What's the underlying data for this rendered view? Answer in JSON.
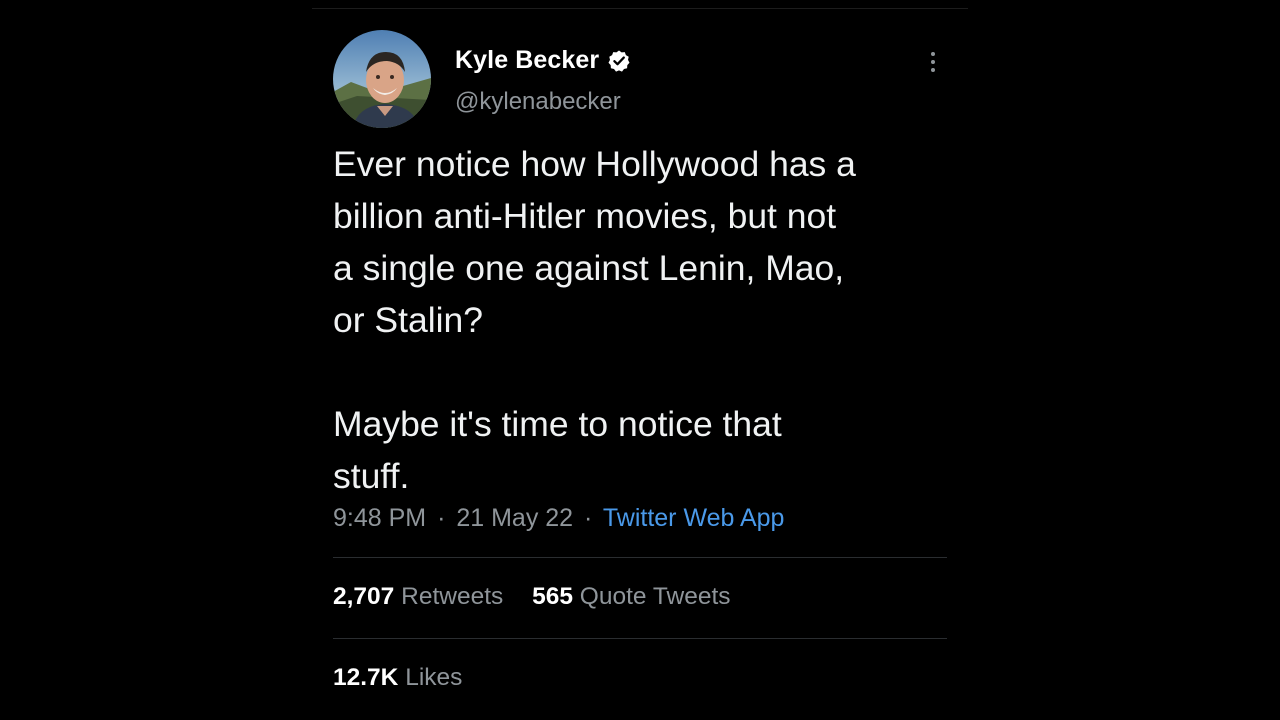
{
  "tweet": {
    "author": {
      "display_name": "Kyle Becker",
      "handle": "@kylenabecker",
      "verified": true
    },
    "body": "Ever notice how Hollywood has a\nbillion anti-Hitler movies, but not\na single one against Lenin, Mao,\nor Stalin?\n\nMaybe it's time to notice that\nstuff.",
    "meta": {
      "time": "9:48 PM",
      "separator": "·",
      "date": "21 May 22",
      "source": "Twitter Web App"
    },
    "stats": {
      "retweets": {
        "count": "2,707",
        "label": "Retweets"
      },
      "quote_tweets": {
        "count": "565",
        "label": "Quote Tweets"
      },
      "likes": {
        "count": "12.7K",
        "label": "Likes"
      }
    }
  },
  "icons": {
    "verified": "verified-badge-icon",
    "more": "more-vertical-icon"
  },
  "colors": {
    "background": "#000000",
    "text": "#e7e9ea",
    "secondary_text": "#8f959a",
    "link": "#4a99e9",
    "divider": "#2a2d30"
  }
}
